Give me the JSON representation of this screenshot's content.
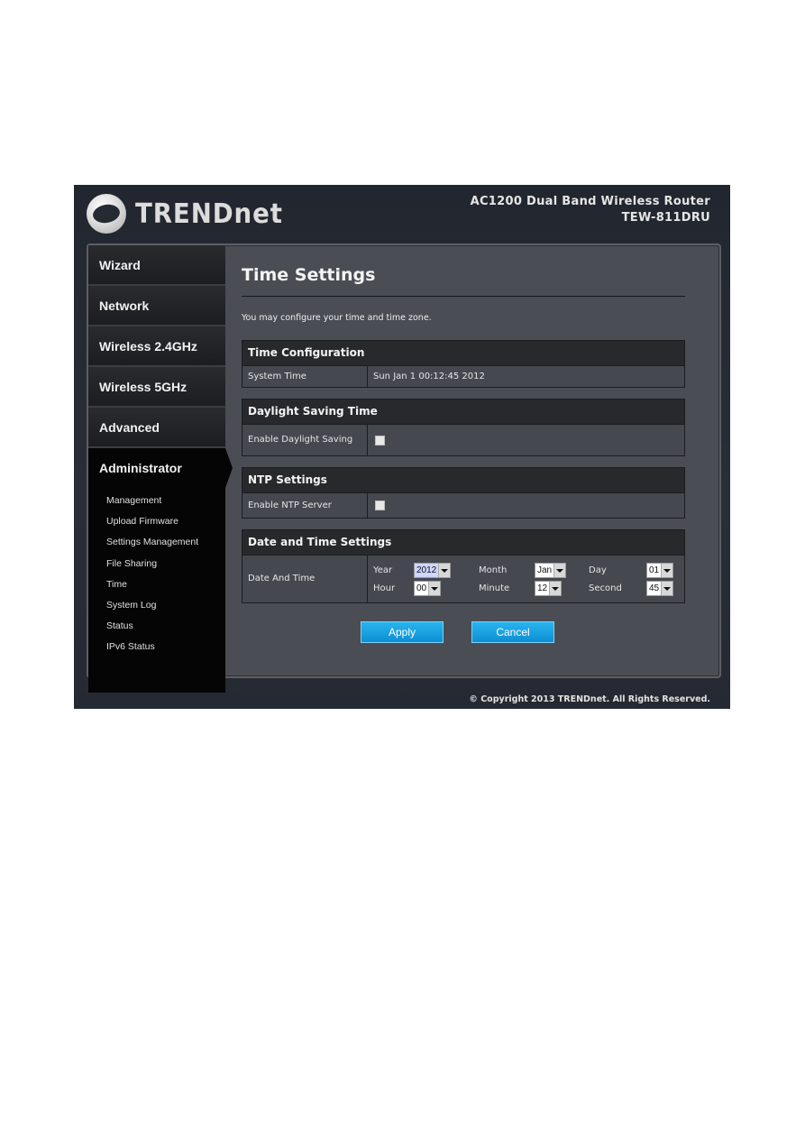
{
  "header": {
    "logo_text": "TRENDnet",
    "product_name": "AC1200 Dual Band Wireless Router",
    "model": "TEW-811DRU"
  },
  "sidebar": {
    "items": [
      {
        "label": "Wizard"
      },
      {
        "label": "Network"
      },
      {
        "label": "Wireless 2.4GHz"
      },
      {
        "label": "Wireless 5GHz"
      },
      {
        "label": "Advanced"
      },
      {
        "label": "Administrator",
        "active": true
      }
    ],
    "subitems": [
      {
        "label": "Management"
      },
      {
        "label": "Upload Firmware"
      },
      {
        "label": "Settings Management"
      },
      {
        "label": "File Sharing"
      },
      {
        "label": "Time",
        "active": true
      },
      {
        "label": "System Log"
      },
      {
        "label": "Status"
      },
      {
        "label": "IPv6 Status"
      }
    ]
  },
  "main": {
    "title": "Time Settings",
    "intro": "You may configure your time and time zone.",
    "time_config": {
      "heading": "Time Configuration",
      "system_time_label": "System Time",
      "system_time_value": "Sun Jan 1 00:12:45 2012"
    },
    "daylight": {
      "heading": "Daylight Saving Time",
      "enable_label": "Enable Daylight Saving",
      "checked": false
    },
    "ntp": {
      "heading": "NTP Settings",
      "enable_label": "Enable NTP Server",
      "checked": false
    },
    "datetime": {
      "heading": "Date and Time Settings",
      "row_label": "Date And Time",
      "year_label": "Year",
      "year_value": "2012",
      "month_label": "Month",
      "month_value": "Jan",
      "day_label": "Day",
      "day_value": "01",
      "hour_label": "Hour",
      "hour_value": "00",
      "minute_label": "Minute",
      "minute_value": "12",
      "second_label": "Second",
      "second_value": "45"
    },
    "buttons": {
      "apply": "Apply",
      "cancel": "Cancel"
    }
  },
  "footer": {
    "copyright": "© Copyright 2013 TRENDnet. All Rights Reserved."
  }
}
